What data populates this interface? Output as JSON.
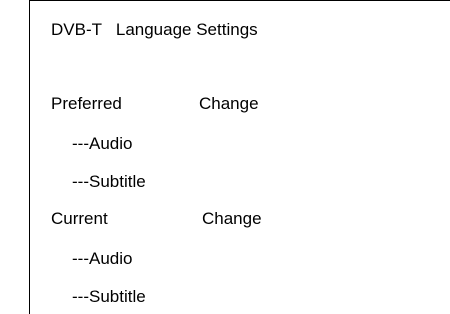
{
  "screen": {
    "title": "DVB-T   Language Settings"
  },
  "preferred": {
    "label": "Preferred",
    "change_label": "Change",
    "audio_label": "---Audio",
    "subtitle_label": "---Subtitle"
  },
  "current": {
    "label": "Current",
    "change_label": "Change",
    "audio_label": "---Audio",
    "subtitle_label": "---Subtitle"
  }
}
